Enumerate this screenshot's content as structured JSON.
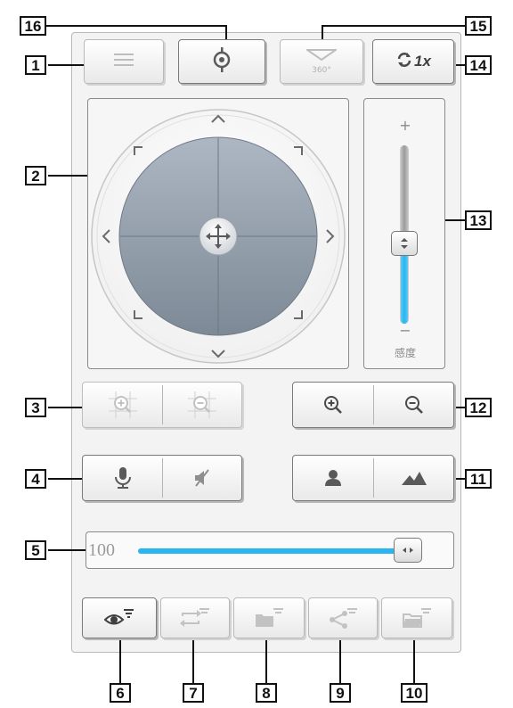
{
  "callouts": [
    "1",
    "2",
    "3",
    "4",
    "5",
    "6",
    "7",
    "8",
    "9",
    "10",
    "11",
    "12",
    "13",
    "14",
    "15",
    "16"
  ],
  "toolbar": {
    "menu_icon": "menu-icon",
    "preset_icon": "target-icon",
    "view360_label": "360°",
    "speed_label": "1x"
  },
  "ptz": {
    "center_icon": "move-icon"
  },
  "sensitivity": {
    "plus": "+",
    "minus": "−",
    "label": "感度",
    "level": 0.45
  },
  "volume": {
    "value": "100",
    "level": 0.96
  },
  "colors": {
    "accent": "#29b6f0",
    "panel": "#f3f3f3",
    "border": "#8a8a8a"
  }
}
